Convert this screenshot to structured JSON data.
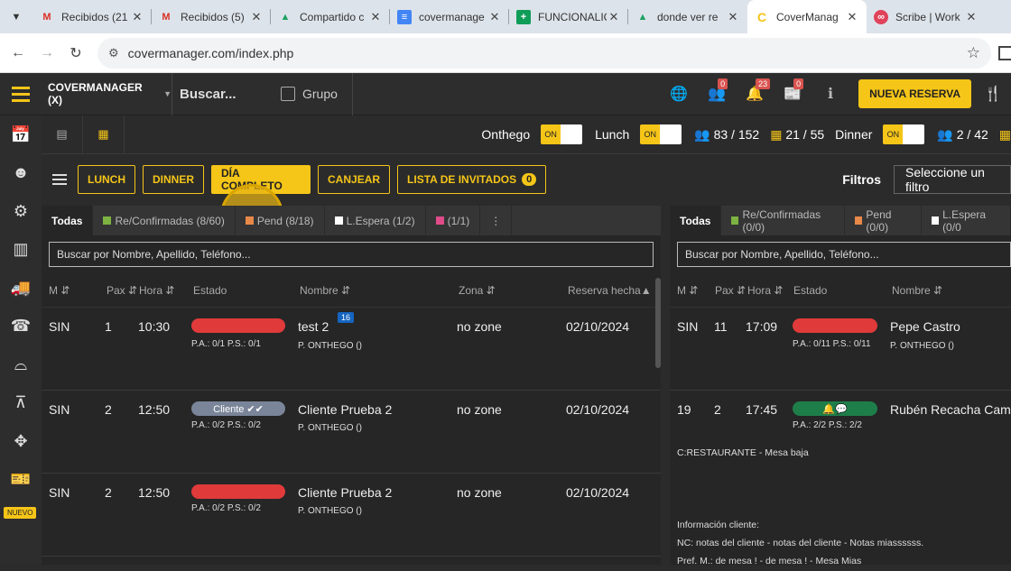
{
  "browser": {
    "tabs": [
      {
        "title": "Recibidos (21",
        "icon": "gmail-icon",
        "active": false
      },
      {
        "title": "Recibidos (5)",
        "icon": "gmail-icon",
        "active": false
      },
      {
        "title": "Compartido c",
        "icon": "drive-icon",
        "active": false
      },
      {
        "title": "covermanage",
        "icon": "docs-icon",
        "active": false
      },
      {
        "title": "FUNCIONALIC",
        "icon": "sheets-icon",
        "active": false
      },
      {
        "title": "donde ver re",
        "icon": "drive-icon",
        "active": false
      },
      {
        "title": "CoverManag",
        "icon": "covermanager-icon",
        "active": true
      },
      {
        "title": "Scribe | Work",
        "icon": "scribe-icon",
        "active": false
      }
    ],
    "url": "covermanager.com/index.php"
  },
  "topbar": {
    "brand": "COVERMANAGER (X)",
    "search_label": "Buscar...",
    "grupo_label": "Grupo",
    "badges": {
      "users": "0",
      "alerts": "23",
      "news": "0"
    },
    "new_reservation": "NUEVA RESERVA"
  },
  "services": {
    "onthego": {
      "label": "Onthego",
      "toggle": "ON"
    },
    "lunch": {
      "label": "Lunch",
      "toggle": "ON",
      "pax": "83 / 152",
      "tables": "21 / 55"
    },
    "dinner": {
      "label": "Dinner",
      "toggle": "ON",
      "pax": "2 / 42"
    }
  },
  "filters_row": {
    "buttons": [
      "LUNCH",
      "DINNER",
      "DÍA COMPLETO",
      "CANJEAR"
    ],
    "invitados_label": "LISTA DE INVITADOS",
    "invitados_count": "0",
    "filtros_label": "Filtros",
    "filtro_select": "Seleccione un filtro"
  },
  "left_panel": {
    "tabs": {
      "todas": "Todas",
      "confirmadas": "Re/Confirmadas (8/60)",
      "pend": "Pend (8/18)",
      "espera": "L.Espera (1/2)",
      "otro": "(1/1)",
      "more": "⋮"
    },
    "search_placeholder": "Buscar por Nombre, Apellido, Teléfono...",
    "columns": {
      "m": "M ⇵",
      "pax": "Pax ⇵",
      "hora": "Hora ⇵",
      "estado": "Estado",
      "nombre": "Nombre ⇵",
      "zona": "Zona ⇵",
      "reserva": "Reserva hecha▲"
    },
    "rows": [
      {
        "m": "SIN",
        "pax": "1",
        "hora": "10:30",
        "estado": "",
        "pa": "P.A.: 0/1 P.S.: 0/1",
        "nombre": "test 2",
        "badge": "16",
        "origen": "P. ONTHEGO ()",
        "zona": "no zone",
        "fecha": "02/10/2024"
      },
      {
        "m": "SIN",
        "pax": "2",
        "hora": "12:50",
        "estado": "Cliente ✔✔",
        "pa": "P.A.: 0/2 P.S.: 0/2",
        "nombre": "Cliente Prueba 2",
        "badge": "",
        "origen": "P. ONTHEGO ()",
        "zona": "no zone",
        "fecha": "02/10/2024"
      },
      {
        "m": "SIN",
        "pax": "2",
        "hora": "12:50",
        "estado": "",
        "pa": "P.A.: 0/2 P.S.: 0/2",
        "nombre": "Cliente Prueba 2",
        "badge": "",
        "origen": "P. ONTHEGO ()",
        "zona": "no zone",
        "fecha": "02/10/2024"
      }
    ]
  },
  "right_panel": {
    "tabs": {
      "todas": "Todas",
      "confirmadas": "Re/Confirmadas (0/0)",
      "pend": "Pend (0/0)",
      "espera": "L.Espera (0/0"
    },
    "search_placeholder": "Buscar por Nombre, Apellido, Teléfono...",
    "columns": {
      "m": "M ⇵",
      "pax": "Pax ⇵",
      "hora": "Hora ⇵",
      "estado": "Estado",
      "nombre": "Nombre ⇵"
    },
    "rows": [
      {
        "m": "SIN",
        "pax": "11",
        "hora": "17:09",
        "estado": "",
        "pa": "P.A.: 0/11 P.S.: 0/11",
        "nombre": "Pepe Castro",
        "origen": "P. ONTHEGO ()"
      },
      {
        "m": "19",
        "pax": "2",
        "hora": "17:45",
        "estado": "🔔💬",
        "pa": "P.A.: 2/2 P.S.: 2/2",
        "nombre": "Rubén Recacha Cama",
        "origen": ""
      }
    ],
    "notes": {
      "restaurante": "C:RESTAURANTE - Mesa baja",
      "info": "Información cliente:",
      "nc": "NC: notas del cliente - notas del cliente - Notas miassssss.",
      "pref": "Pref. M.: de mesa ! - de mesa ! - Mesa Mias"
    }
  },
  "sidebar": {
    "nuevo_badge": "NUEVO"
  },
  "colors": {
    "accent": "#f5c518",
    "status_red": "#e03a3a",
    "status_grey": "#7a8599",
    "status_green": "#1e7e4a"
  }
}
